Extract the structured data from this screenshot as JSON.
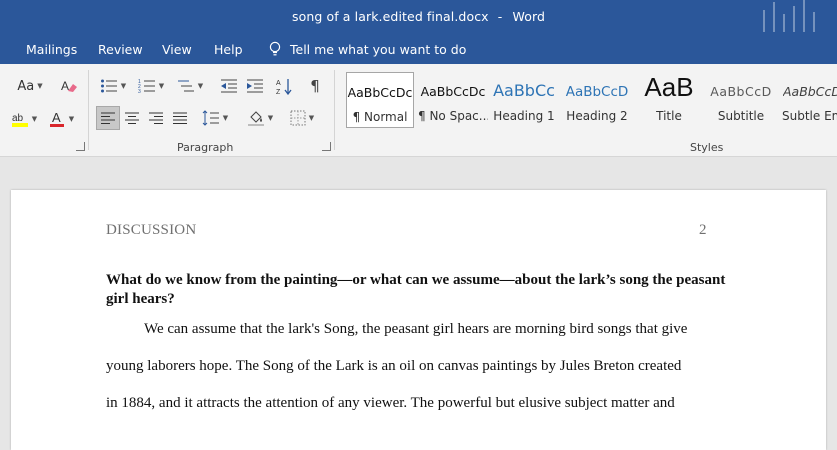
{
  "window": {
    "filename": "song of a lark.edited final.docx",
    "separator": "-",
    "app": "Word"
  },
  "menu": {
    "items": [
      "Mailings",
      "Review",
      "View",
      "Help"
    ],
    "tell_me": "Tell me what you want to do"
  },
  "ribbon": {
    "font_group": {
      "change_case": "Aa"
    },
    "paragraph_group": {
      "label": "Paragraph",
      "active_alignment": "align-left"
    },
    "styles_group": {
      "label": "Styles",
      "styles": [
        {
          "preview": "AaBbCcDc",
          "name": "¶ Normal",
          "selected": true
        },
        {
          "preview": "AaBbCcDc",
          "name": "¶ No Spac..."
        },
        {
          "preview": "AaBbCc",
          "name": "Heading 1"
        },
        {
          "preview": "AaBbCcD",
          "name": "Heading 2"
        },
        {
          "preview": "AaB",
          "name": "Title"
        },
        {
          "preview": "AaBbCcD",
          "name": "Subtitle"
        },
        {
          "preview": "AaBbCcD",
          "name": "Subtle Em..."
        }
      ]
    }
  },
  "colors": {
    "brand": "#2b579a",
    "highlight": "#ffff00",
    "font_color": "#d9262b",
    "heading": "#2e74b5"
  },
  "document": {
    "running_head": "DISCUSSION",
    "page_number": "2",
    "question": "What do we know from the painting—or what can we assume—about the lark’s song the peasant girl hears?",
    "lines": [
      "We can assume that the lark's Song, the peasant girl hears are morning bird songs that give",
      "young laborers hope.  The Song of the Lark is an oil on canvas paintings by Jules Breton created",
      "in 1884, and it attracts the attention of any viewer. The powerful but elusive subject matter and"
    ]
  }
}
